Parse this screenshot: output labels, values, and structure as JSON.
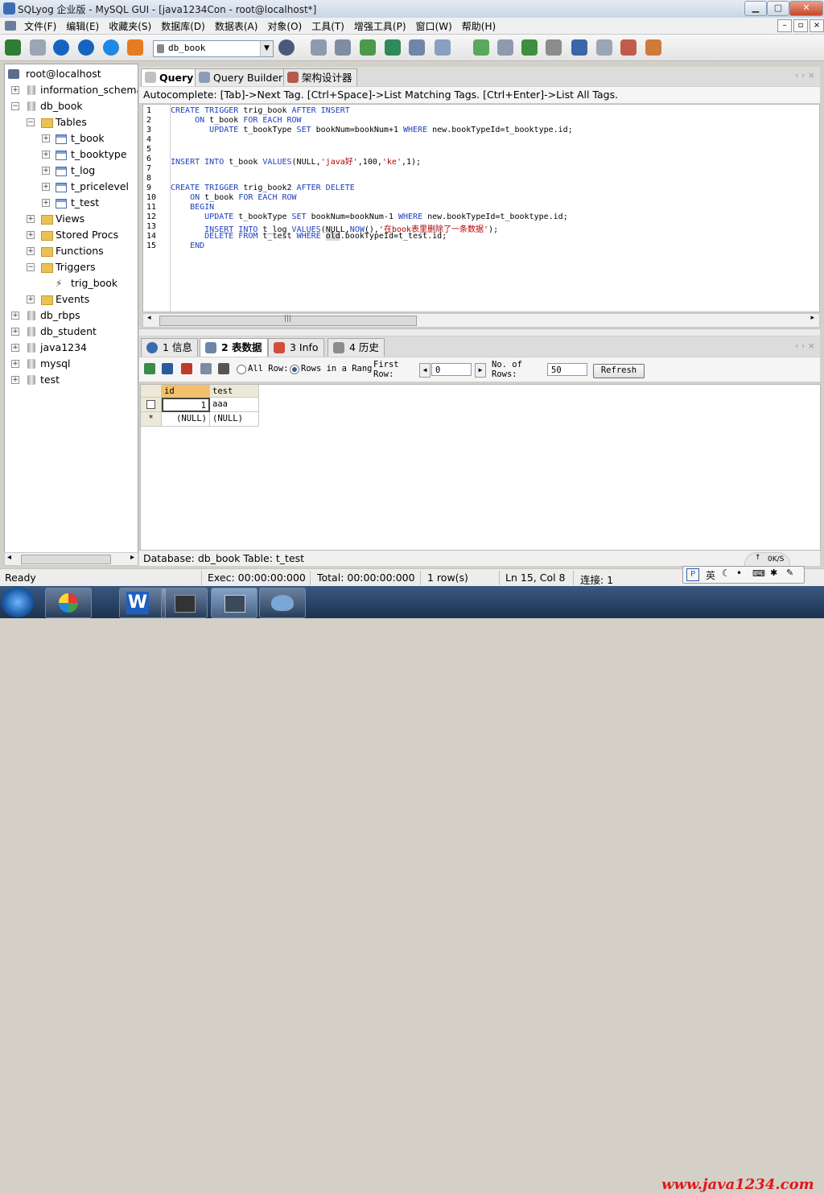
{
  "window": {
    "title": "SQLyog 企业版 - MySQL GUI - [java1234Con - root@localhost*]",
    "minimize": "▁",
    "restore": "▢",
    "close": "✕"
  },
  "menubar": {
    "items": [
      "文件(F)",
      "编辑(E)",
      "收藏夹(S)",
      "数据库(D)",
      "数据表(A)",
      "对象(O)",
      "工具(T)",
      "增强工具(P)",
      "窗口(W)",
      "帮助(H)"
    ],
    "mdi_min": "–",
    "mdi_restore": "▫",
    "mdi_close": "×"
  },
  "toolbar": {
    "database_select": "db_book"
  },
  "tree": {
    "root": "root@localhost",
    "items": [
      {
        "label": "information_schema"
      },
      {
        "label": "db_book"
      },
      {
        "label": "Tables"
      },
      {
        "label": "t_book"
      },
      {
        "label": "t_booktype"
      },
      {
        "label": "t_log"
      },
      {
        "label": "t_pricelevel"
      },
      {
        "label": "t_test"
      },
      {
        "label": "Views"
      },
      {
        "label": "Stored Procs"
      },
      {
        "label": "Functions"
      },
      {
        "label": "Triggers"
      },
      {
        "label": "trig_book"
      },
      {
        "label": "Events"
      },
      {
        "label": "db_rbps"
      },
      {
        "label": "db_student"
      },
      {
        "label": "java1234"
      },
      {
        "label": "mysql"
      },
      {
        "label": "test"
      }
    ],
    "scroll_left": "◂",
    "scroll_right": "▸"
  },
  "query_tabs": [
    "Query",
    "Query Builder",
    "架构设计器"
  ],
  "autocomplete": "Autocomplete: [Tab]->Next Tag. [Ctrl+Space]->List Matching Tags. [Ctrl+Enter]->List All Tags.",
  "editor": {
    "line_numbers": [
      "1",
      "2",
      "3",
      "4",
      "5",
      "6",
      "7",
      "8",
      "9",
      "10",
      "11",
      "12",
      "13",
      "14",
      "15"
    ]
  },
  "result_tabs": [
    "1 信息",
    "2 表数据",
    "3 Info",
    "4 历史"
  ],
  "result_toolbar": {
    "all_rows": "All Row:",
    "rows_in_range": "Rows in a Rang",
    "first_row": "First Row:",
    "first_row_value": "0",
    "no_of_rows": "No. of Rows:",
    "no_of_rows_value": "50",
    "refresh": "Refresh"
  },
  "grid": {
    "columns": [
      "id",
      "test"
    ],
    "rows": [
      {
        "marker": "",
        "id": "1",
        "test": "aaa"
      },
      {
        "marker": "*",
        "id": "(NULL)",
        "test": "(NULL)"
      }
    ]
  },
  "db_line": "Database: db_book Table: t_test",
  "statusbar": {
    "ready": "Ready",
    "exec": "Exec: 00:00:00:000",
    "total": "Total: 00:00:00:000",
    "rows": "1 row(s)",
    "position": "Ln 15, Col 8",
    "connections": "连接: 1"
  },
  "ime": {
    "lang": "英"
  },
  "netspeed": {
    "value": "0K/S"
  },
  "watermark": "www.java1234.com",
  "colors": {
    "keyword": "#1f3fbf",
    "string": "#b00000",
    "accent": "#3b6db5"
  }
}
